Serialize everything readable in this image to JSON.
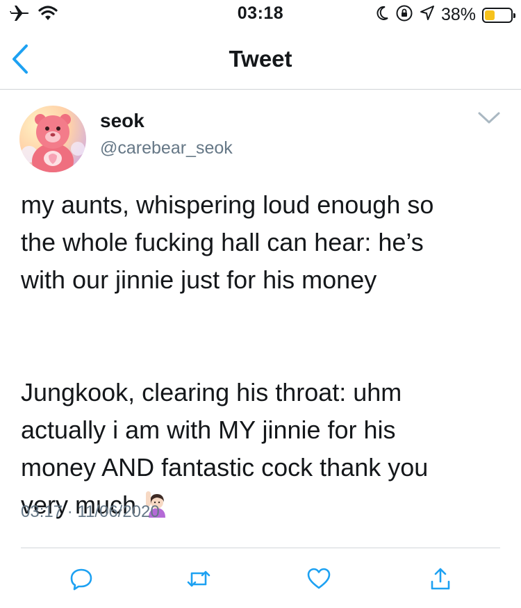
{
  "status_bar": {
    "time": "03:18",
    "battery_percent": "38%",
    "battery_level": 0.38,
    "icons": [
      "airplane-icon",
      "wifi-icon",
      "moon-icon",
      "rotation-lock-icon",
      "location-icon",
      "battery-icon"
    ]
  },
  "nav": {
    "title": "Tweet",
    "back_icon": "chevron-left-icon"
  },
  "tweet": {
    "display_name": "seok",
    "handle": "@carebear_seok",
    "text": "my aunts, whispering loud enough so\nthe whole fucking hall can hear: he’s\nwith our jinnie just for his money\n\n\nJungkook, clearing his throat: uhm\nactually i am with MY jinnie for his\nmoney AND fantastic cock thank you\nvery much",
    "emoji": "person-raising-hand-emoji",
    "timestamp": "03:17 · 11/06/2020"
  },
  "actions": [
    "reply-icon",
    "retweet-icon",
    "like-icon",
    "share-icon"
  ],
  "colors": {
    "accent": "#1da1f2",
    "secondary_text": "#657786",
    "action_icon": "#1da1f2",
    "battery": "#f6c21c"
  }
}
